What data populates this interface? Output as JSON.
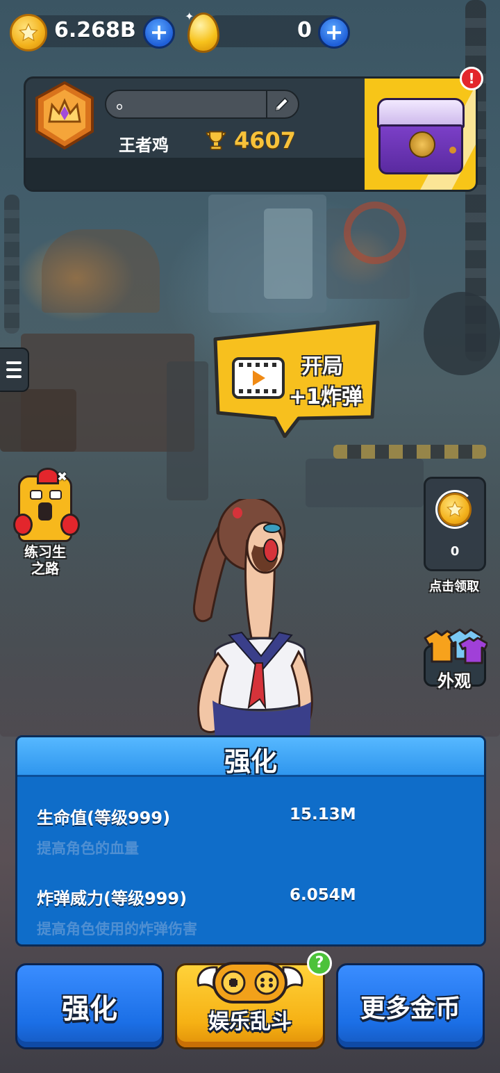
{
  "currency": {
    "coins": "6.268B",
    "eggs": "0",
    "coin_icon": "star-coin-icon",
    "egg_icon": "golden-egg-icon",
    "add_icon": "plus-icon"
  },
  "profile": {
    "player_name": "。",
    "rank_title": "王者鸡",
    "trophies": "4607",
    "rank_badge_icon": "crown-badge-icon",
    "edit_icon": "pencil-icon",
    "chest_icon": "purple-chest-icon",
    "alert_text": "!"
  },
  "promo": {
    "line1": "开局",
    "line2": "+1炸弹",
    "icon": "video-play-icon"
  },
  "side_left": {
    "label_line1": "练习生",
    "label_line2": "之路",
    "icon": "chicken-mascot-icon"
  },
  "side_right": {
    "collect_count": "0",
    "collect_label": "点击领取",
    "outfit_label": "外观",
    "coin_icon": "star-coin-icon",
    "outfit_icon": "shirts-icon"
  },
  "upgrade": {
    "title": "强化",
    "stats": [
      {
        "label": "生命值(等级999)",
        "value": "15.13M",
        "desc": "提高角色的血量"
      },
      {
        "label": "炸弹威力(等级999)",
        "value": "6.054M",
        "desc": "提高角色使用的炸弹伤害"
      }
    ]
  },
  "bottom": {
    "left_label": "强化",
    "center_label": "娱乐乱斗",
    "right_label": "更多金币",
    "help_text": "?",
    "center_icon": "winged-gamepad-icon"
  },
  "colors": {
    "accent_blue": "#1b6fe6",
    "accent_gold": "#f6b114",
    "panel_blue": "#0f6dc9",
    "trophy_gold": "#f7c23a"
  }
}
